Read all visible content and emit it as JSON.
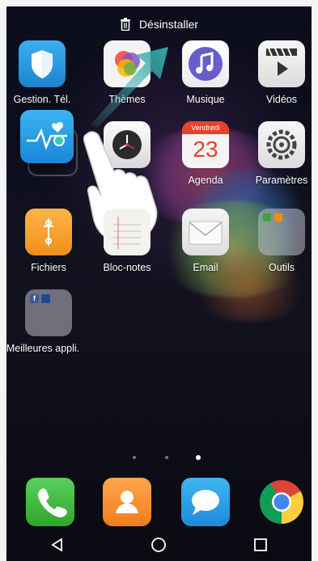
{
  "top_bar": {
    "uninstall_label": "Désinstaller",
    "icon": "trash-icon"
  },
  "apps": {
    "phone_manager": "Gestion. Tél.",
    "themes": "Thèmes",
    "music": "Musique",
    "videos": "Vidéos",
    "calendar": "Agenda",
    "calendar_day": "Vendredi",
    "calendar_date": "23",
    "settings": "Paramètres",
    "files": "Fichiers",
    "notes": "Bloc-notes",
    "email": "Email",
    "tools": "Outils",
    "top_apps": "Meilleures appli."
  },
  "page_indicator": {
    "pages": 3,
    "current": 3
  },
  "dock": [
    "phone-icon",
    "contacts-icon",
    "messages-icon",
    "chrome-icon"
  ],
  "navigation": [
    "back-icon",
    "home-icon",
    "recents-icon"
  ]
}
